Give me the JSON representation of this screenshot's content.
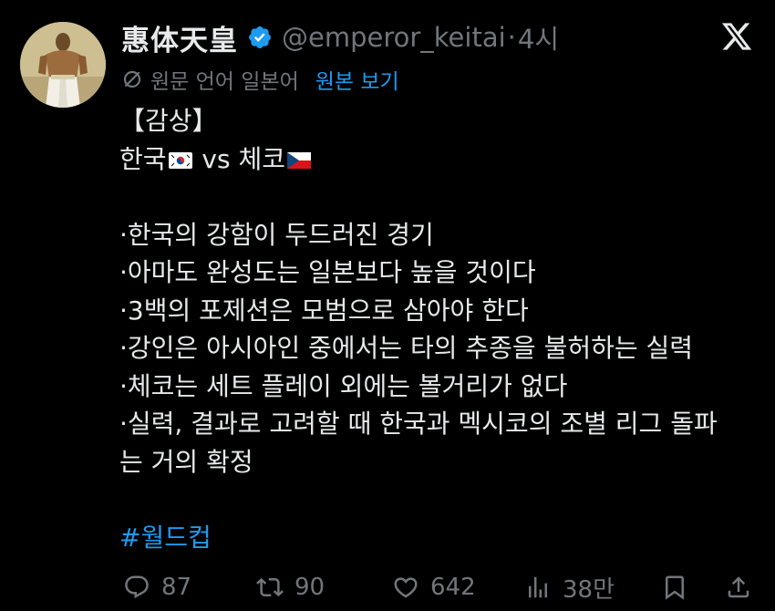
{
  "post": {
    "author": {
      "display_name": "惠体天皇",
      "handle": "@emperor_keitai",
      "verified": true,
      "avatar_icon": "avatar-emperor-portrait"
    },
    "separator": "·",
    "time": "4시",
    "platform_icon": "x-logo-icon",
    "translation": {
      "icon": "translate-icon",
      "text": "원문 언어 일본어",
      "show_original": "원본 보기"
    },
    "body": {
      "line1": "【감상】",
      "line2": {
        "team1": "한국",
        "vs": " vs ",
        "team2": "체코"
      },
      "line3": "·한국의 강함이 두드러진 경기",
      "line4": "·아마도 완성도는 일본보다 높을 것이다",
      "line5": "·3백의 포제션은 모범으로 삼아야 한다",
      "line6": "·강인은 아시아인 중에서는 타의 추종을 불허하는 실력",
      "line7": "·체코는 세트 플레이 외에는 볼거리가 없다",
      "line8": "·실력, 결과로 고려할 때 한국과 멕시코의 조별 리그 돌파",
      "line9": "는 거의 확정",
      "hashtag": "#월드컵"
    },
    "actions": {
      "replies": "87",
      "reposts": "90",
      "likes": "642",
      "views": "38만"
    },
    "colors": {
      "background": "#000000",
      "text": "#e7e9ea",
      "muted": "#71767b",
      "accent": "#1d9bf0"
    }
  }
}
